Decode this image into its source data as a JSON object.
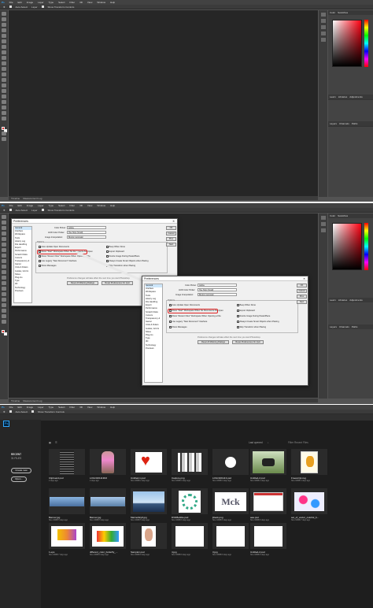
{
  "menu": [
    "Ps",
    "File",
    "Edit",
    "Image",
    "Layer",
    "Type",
    "Select",
    "Filter",
    "3D",
    "View",
    "Window",
    "Help"
  ],
  "options": {
    "auto_select": "Auto-Select",
    "layer": "Layer",
    "show_transform": "Show Transform Controls"
  },
  "panel": {
    "tab_color": "Color",
    "tab_swatches": "Swatches",
    "tab_learn": "Learn",
    "tab_libraries": "Libraries",
    "tab_adjustments": "Adjustments",
    "tab_layers": "Layers",
    "tab_channels": "Channels",
    "tab_paths": "Paths"
  },
  "status": {
    "tab1": "Timeline",
    "tab2": "Measurement Log"
  },
  "colors": {
    "accent": "#31a8ff",
    "foreground": "#e0302c",
    "highlight": "#d22222"
  },
  "prefs": {
    "title": "Preferences",
    "categories": [
      "General",
      "Interface",
      "Workspace",
      "Tools",
      "History Log",
      "File Handling",
      "Export",
      "Performance",
      "Scratch Disks",
      "Cursors",
      "Transparency & Gamut",
      "Units & Rulers",
      "Guides, Grid & Slices",
      "Plug-Ins",
      "Type",
      "3D",
      "Technology Previews"
    ],
    "color_picker_label": "Color Picker:",
    "color_picker_value": "Adobe",
    "hud_label": "HUD Color Picker:",
    "hud_value": "Hue Strip (Small)",
    "interp_label": "Image Interpolation:",
    "interp_value": "Bicubic Automatic",
    "options_label": "Options",
    "opt_auto_update": "Auto-Update Open Documents",
    "opt_show_start": "Show \"Start\" Workspace When No Documents Are Open",
    "opt_show_recent": "Show \"Recent Files\" Workspace When Opening a File",
    "opt_legacy_new": "Use Legacy \"New Document\" Interface",
    "opt_show_messages": "Show Messages",
    "opt_beep": "Beep When Done",
    "opt_export_clip": "Export Clipboard",
    "opt_resize_paste": "Resize Image During Paste/Place",
    "opt_always_smart": "Always Create Smart Objects when Placing",
    "opt_skip_transform": "Skip Transform when Placing",
    "note": "Preference changes will take effect the next time you start Photoshop.",
    "reset_warn": "Reset All Warning Dialogs",
    "reset_quit": "Reset Preferences On Quit",
    "ok": "OK",
    "cancel": "Cancel",
    "prev": "Prev",
    "next": "Next"
  },
  "home": {
    "recent": "RECENT",
    "files_count": "31 FILES",
    "create_new": "Create new",
    "open": "Open...",
    "sort_label": "Last opened",
    "filter_placeholder": "Filter Recent Files"
  },
  "files": [
    {
      "name": "Clipboard.psd",
      "meta": "2 days ago"
    },
    {
      "name": "LOGO201113D2",
      "meta": "2 days ago"
    },
    {
      "name": "Untitled-1.psd",
      "meta": "Size 63MB 2 days ago"
    },
    {
      "name": "Capture.png",
      "meta": "Size 63MB 3 days ago"
    },
    {
      "name": "LOGO201113.psd",
      "meta": "Size 63MB 3 days ago"
    },
    {
      "name": "Untitled-2.psd",
      "meta": "Size 63MB 4 days ago"
    },
    {
      "name": "Freescript.svg",
      "meta": "Size 63MB 4 days ago"
    },
    {
      "name": "Banner.jpg",
      "meta": "Size 63MB 5 days ago"
    },
    {
      "name": "Banner.jpg",
      "meta": "Size 63MB 5 days ago"
    },
    {
      "name": "MarineSky9.jpg",
      "meta": "Size 63MB 5 days ago"
    },
    {
      "name": "DVDBubble.psd",
      "meta": "Size 63MB 6 days ago"
    },
    {
      "name": "jblack.png",
      "meta": "Size 63MB 6 days ago"
    },
    {
      "name": "aaa.psd",
      "meta": "Size 63MB 6 days ago"
    },
    {
      "name": "set_of_vector_colorful_b...",
      "meta": "Size 63MB 7 days ago"
    },
    {
      "name": "1.eps",
      "meta": "Size 63MB 7 days ago"
    },
    {
      "name": "different_color_butterfly_...",
      "meta": "Size 63MB 8 days ago"
    },
    {
      "name": "Sample1.psd",
      "meta": "Size 63MB 8 days ago"
    },
    {
      "name": "4.jpg",
      "meta": "Size 63MB 9 days ago"
    },
    {
      "name": "3.jpg",
      "meta": "Size 63MB 9 days ago"
    },
    {
      "name": "Untitled-2.psd",
      "meta": "Size 63MB 9 days ago"
    }
  ]
}
